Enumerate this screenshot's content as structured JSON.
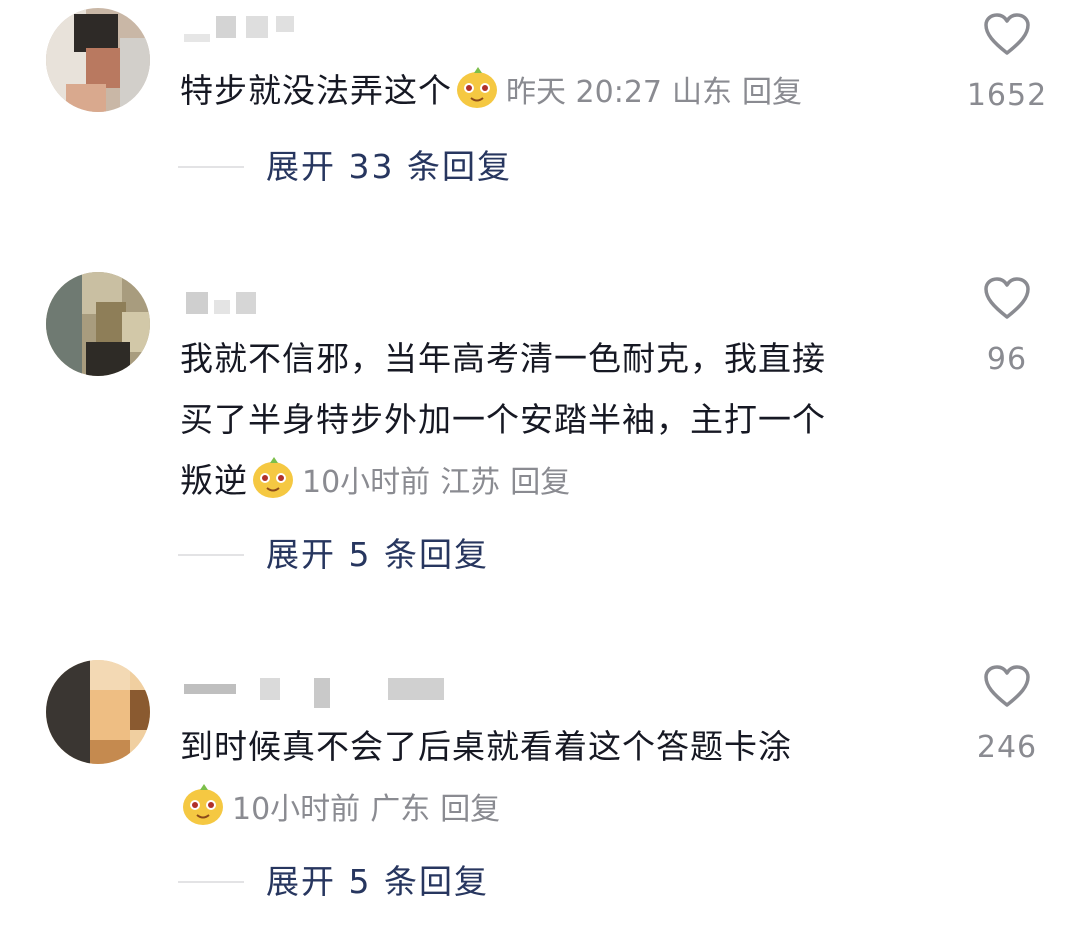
{
  "comments": [
    {
      "text_lines": [
        "特步就没法弄这个"
      ],
      "emoji": "smiling-face-emoji",
      "time": "昨天 20:27",
      "location": "山东",
      "reply_label": "回复",
      "likes": "1652",
      "expand_label": "展开 33 条回复"
    },
    {
      "text_lines": [
        "我就不信邪，当年高考清一色耐克，我直接",
        "买了半身特步外加一个安踏半袖，主打一个",
        "叛逆"
      ],
      "emoji": "smiling-face-emoji",
      "time": "10小时前",
      "location": "江苏",
      "reply_label": "回复",
      "likes": "96",
      "expand_label": "展开 5 条回复"
    },
    {
      "text_lines": [
        "到时候真不会了后桌就看着这个答题卡涂"
      ],
      "emoji": "smiling-face-emoji",
      "time": "10小时前",
      "location": "广东",
      "reply_label": "回复",
      "likes": "246",
      "expand_label": "展开 5 条回复"
    }
  ],
  "colors": {
    "text": "#161823",
    "meta": "#8a8b91",
    "expand": "#27365f",
    "heart": "#8a8b91",
    "emoji_face": "#f5c842"
  }
}
